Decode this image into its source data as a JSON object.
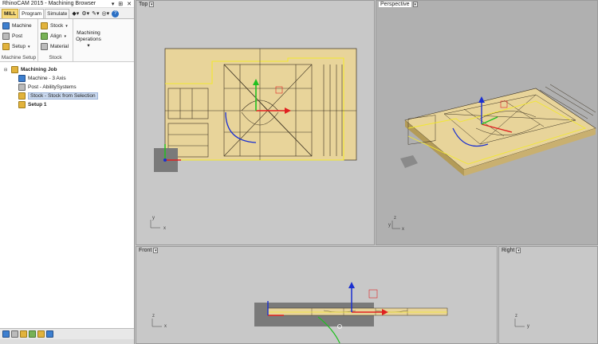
{
  "window": {
    "title": "RhinoCAM 2015 - Machining Browser",
    "controls": [
      "▾",
      "⊞",
      "✕"
    ]
  },
  "tabs": [
    {
      "label": "MILL",
      "kind": "mill"
    },
    {
      "label": "Program",
      "kind": "active"
    },
    {
      "label": "Simulate",
      "kind": "normal"
    }
  ],
  "toolbar_icons": [
    "◆▾",
    "⚙▾",
    "✎▾",
    "◎▾"
  ],
  "help_icon": "?",
  "ribbon": {
    "machine_setup": {
      "name": "Machine Setup",
      "items": [
        {
          "label": "Machine",
          "icon": "machine-icon"
        },
        {
          "label": "Post",
          "icon": "post-icon"
        },
        {
          "label": "Setup",
          "icon": "setup-icon",
          "caret": "▾"
        }
      ]
    },
    "stock": {
      "name": "Stock",
      "items": [
        {
          "label": "Stock",
          "icon": "stock-icon",
          "caret": "▾"
        },
        {
          "label": "Align",
          "icon": "align-icon",
          "caret": "▾"
        },
        {
          "label": "Material",
          "icon": "material-icon"
        }
      ]
    },
    "machining_operations": {
      "line1": "Machining",
      "line2": "Operations",
      "caret": "▾"
    }
  },
  "tree": {
    "root": {
      "label": "Machining Job",
      "expander": "⊟"
    },
    "children": [
      {
        "label": "Machine - 3 Axis"
      },
      {
        "label": "Post - AbilitySystems"
      },
      {
        "label": "Stock - Stock from Selection",
        "selected": true
      }
    ],
    "setup": {
      "label": "Setup 1"
    }
  },
  "viewports": {
    "top": {
      "label": "Top",
      "axis_y": "y",
      "axis_x": "x"
    },
    "perspective": {
      "label": "Perspective",
      "axis_z": "z",
      "axis_y": "y",
      "axis_x": "x"
    },
    "front": {
      "label": "Front",
      "axis_z": "z",
      "axis_x": "x"
    },
    "right": {
      "label": "Right",
      "axis_z": "z",
      "axis_y": "y"
    }
  },
  "colors": {
    "stock_fill": "#e8d49a",
    "stock_outline": "#f2e830",
    "geometry": "#3a3020",
    "x_axis": "#e02020",
    "y_axis": "#20c020",
    "z_axis": "#1a2fd0",
    "viewport_bg": "#c8c8c8",
    "active_viewport_bg": "#b0b0b0"
  }
}
